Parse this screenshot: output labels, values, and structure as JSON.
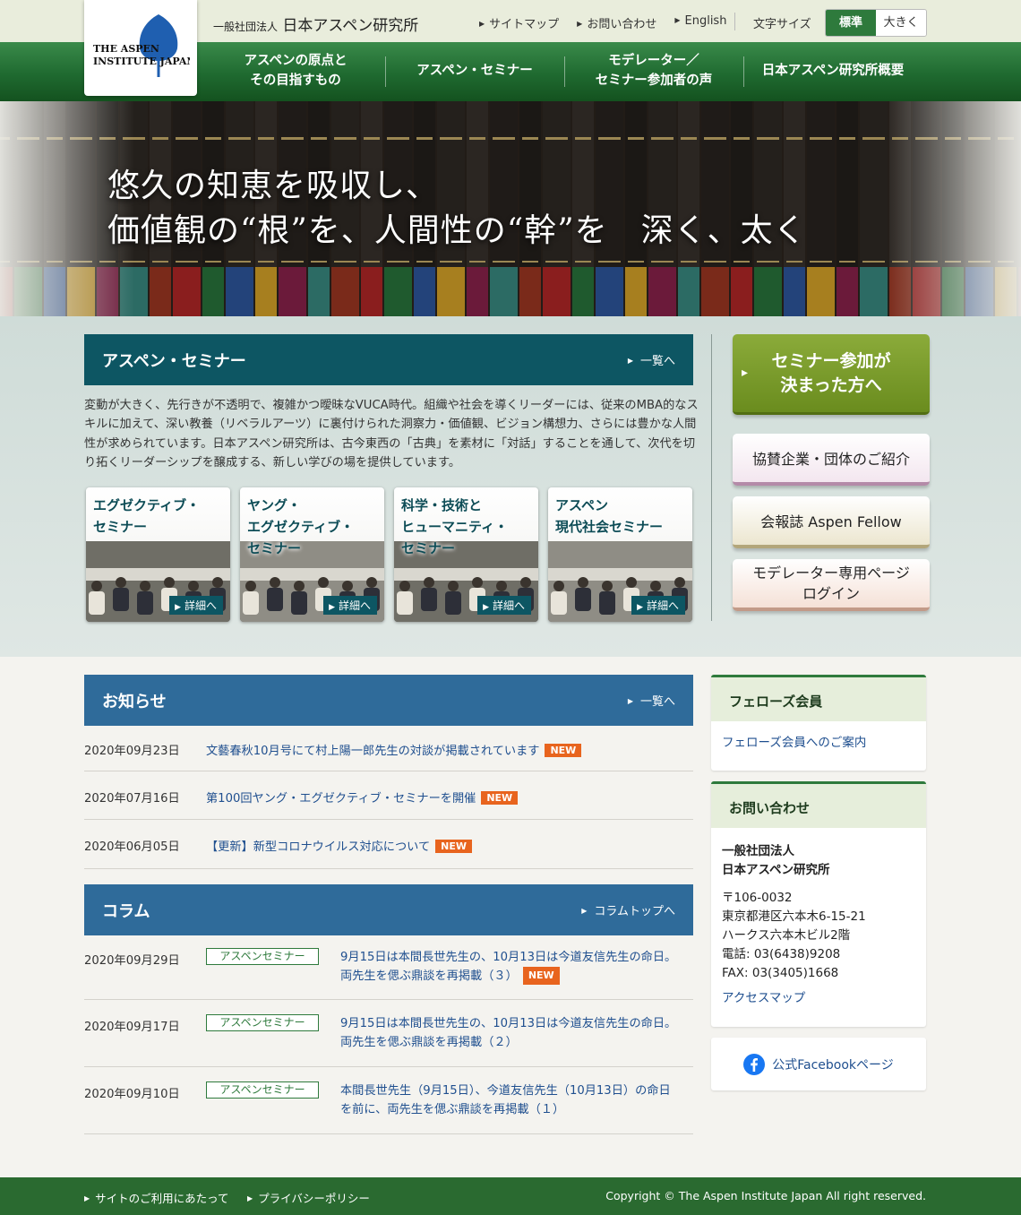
{
  "header": {
    "org_prefix": "一般社団法人",
    "org_name": "日本アスペン研究所",
    "logo_text": "The Aspen Institute Japan",
    "util_links": [
      "サイトマップ",
      "お問い合わせ",
      "English"
    ],
    "font_size_label": "文字サイズ",
    "font_size_normal": "標準",
    "font_size_large": "大きく"
  },
  "nav": {
    "items": [
      "アスペンの原点と\nその目指すもの",
      "アスペン・セミナー",
      "モデレーター／\nセミナー参加者の声",
      "日本アスペン研究所概要"
    ]
  },
  "hero": {
    "line1": "悠久の知恵を吸収し、",
    "line2": "価値観の“根”を、人間性の“幹”を　深く、太く"
  },
  "seminar": {
    "title": "アスペン・セミナー",
    "more": "一覧へ",
    "text": "変動が大きく、先行きが不透明で、複雑かつ曖昧なVUCA時代。組織や社会を導くリーダーには、従来のMBA的なスキルに加えて、深い教養（リベラルアーツ）に裏付けられた洞察力・価値観、ビジョン構想力、さらには豊かな人間性が求められています。日本アスペン研究所は、古今東西の「古典」を素材に「対話」することを通して、次代を切り拓くリーダーシップを醸成する、新しい学びの場を提供しています。",
    "cards": [
      {
        "title": "エグゼクティブ・\nセミナー",
        "detail": "詳細へ"
      },
      {
        "title": "ヤング・\nエグゼクティブ・\nセミナー",
        "detail": "詳細へ"
      },
      {
        "title": "科学・技術と\nヒューマニティ・\nセミナー",
        "detail": "詳細へ"
      },
      {
        "title": "アスペン\n現代社会セミナー",
        "detail": "詳細へ"
      }
    ]
  },
  "side_buttons": {
    "join": "セミナー参加が\n決まった方へ",
    "sponsor": "協賛企業・団体のご紹介",
    "fellow": "会報誌 Aspen Fellow",
    "moderator": "モデレーター専用ページ\nログイン"
  },
  "news": {
    "title": "お知らせ",
    "more": "一覧へ",
    "badge": "NEW",
    "items": [
      {
        "date": "2020年09月23日",
        "text": "文藝春秋10月号にて村上陽一郎先生の対談が掲載されています",
        "new": true
      },
      {
        "date": "2020年07月16日",
        "text": "第100回ヤング・エグゼクティブ・セミナーを開催",
        "new": true
      },
      {
        "date": "2020年06月05日",
        "text": "【更新】新型コロナウイルス対応について",
        "new": true
      }
    ]
  },
  "column": {
    "title": "コラム",
    "more": "コラムトップへ",
    "items": [
      {
        "date": "2020年09月29日",
        "tag": "アスペンセミナー",
        "text": "9月15日は本間長世先生の、10月13日は今道友信先生の命日。両先生を偲ぶ鼎談を再掲載（３）",
        "new": true
      },
      {
        "date": "2020年09月17日",
        "tag": "アスペンセミナー",
        "text": "9月15日は本間長世先生の、10月13日は今道友信先生の命日。両先生を偲ぶ鼎談を再掲載（２）",
        "new": false
      },
      {
        "date": "2020年09月10日",
        "tag": "アスペンセミナー",
        "text": "本間長世先生（9月15日）、今道友信先生（10月13日）の命日を前に、両先生を偲ぶ鼎談を再掲載（１）",
        "new": false
      }
    ]
  },
  "sidebar": {
    "fellows_title": "フェローズ会員",
    "fellows_link": "フェローズ会員へのご案内",
    "contact_title": "お問い合わせ",
    "contact_org1": "一般社団法人",
    "contact_org2": "日本アスペン研究所",
    "postal": "〒106-0032",
    "addr1": "東京都港区六本木6-15-21",
    "addr2": "ハークス六本木ビル2階",
    "tel": "電話: 03(6438)9208",
    "fax": "FAX: 03(3405)1668",
    "access": "アクセスマップ",
    "facebook": "公式Facebookページ"
  },
  "footer": {
    "links": [
      "サイトのご利用にあたって",
      "プライバシーポリシー"
    ],
    "copyright": "Copyright © The Aspen Institute Japan All right reserved."
  },
  "colors": {
    "green": "#2e7a3c",
    "teal": "#0d5663",
    "blue": "#2f6b9a",
    "new_badge": "#e8641e"
  }
}
